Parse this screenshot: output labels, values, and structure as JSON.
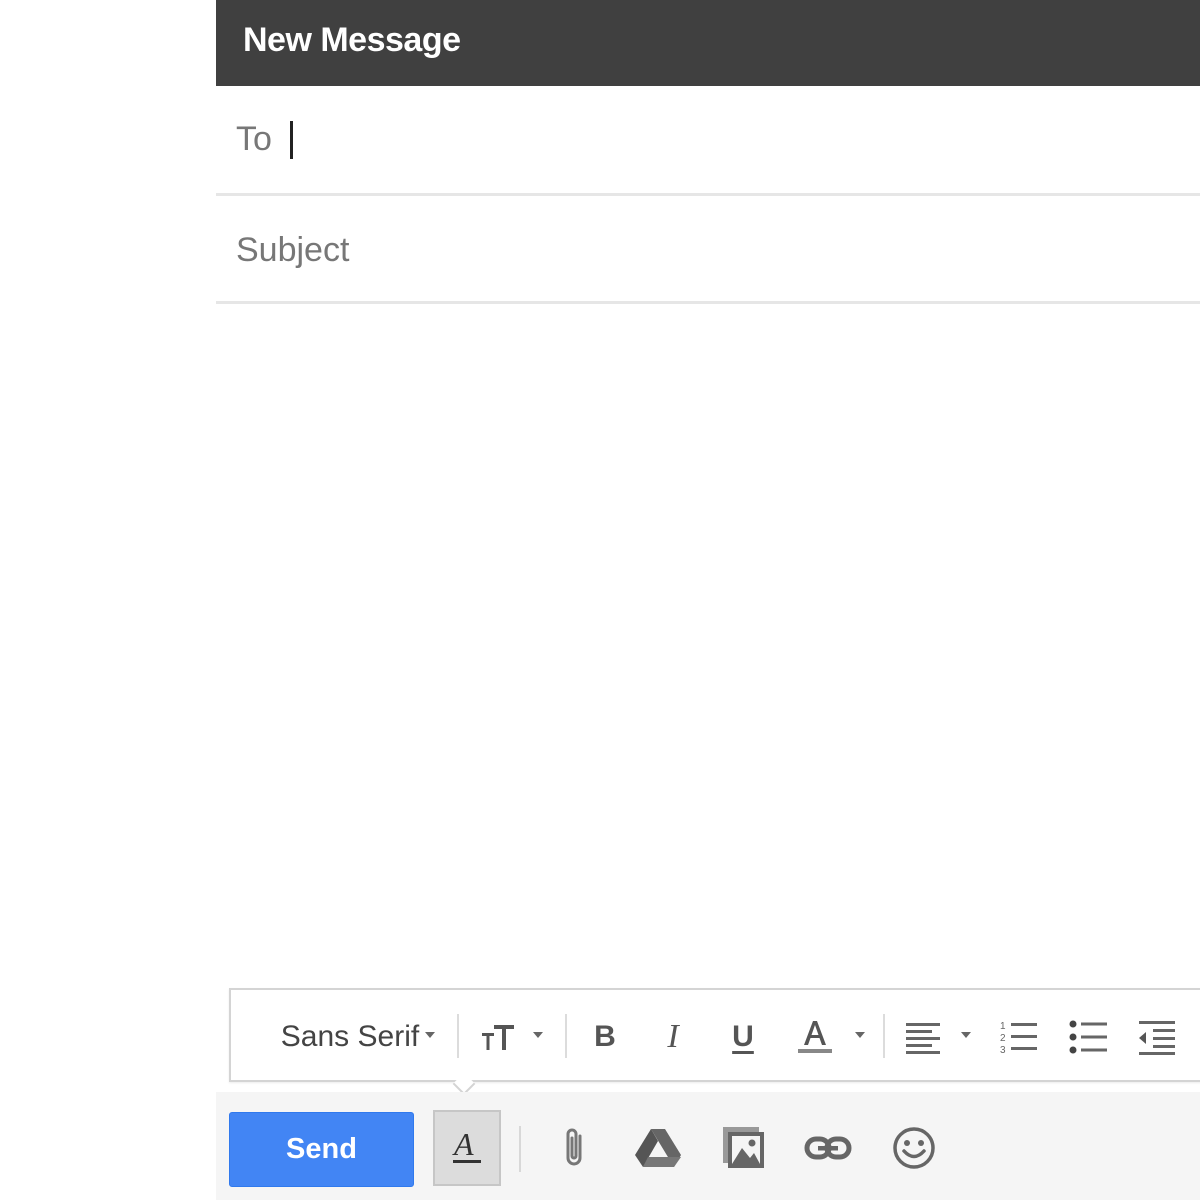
{
  "compose": {
    "title": "New Message",
    "to_label": "To",
    "to_value": "",
    "subject_placeholder": "Subject",
    "subject_value": "",
    "body_value": ""
  },
  "format_toolbar": {
    "font_family": "Sans Serif",
    "buttons": [
      "font-size",
      "bold",
      "italic",
      "underline",
      "text-color",
      "align",
      "numbered-list",
      "bulleted-list",
      "indent-less"
    ]
  },
  "bottom_bar": {
    "send_label": "Send",
    "icons": [
      "formatting-options-icon",
      "attach-icon",
      "drive-icon",
      "insert-photo-icon",
      "link-icon",
      "emoji-icon"
    ]
  },
  "colors": {
    "title_bar": "#404040",
    "send_button": "#4285f4",
    "label_text": "#777777",
    "icon": "#555555"
  }
}
